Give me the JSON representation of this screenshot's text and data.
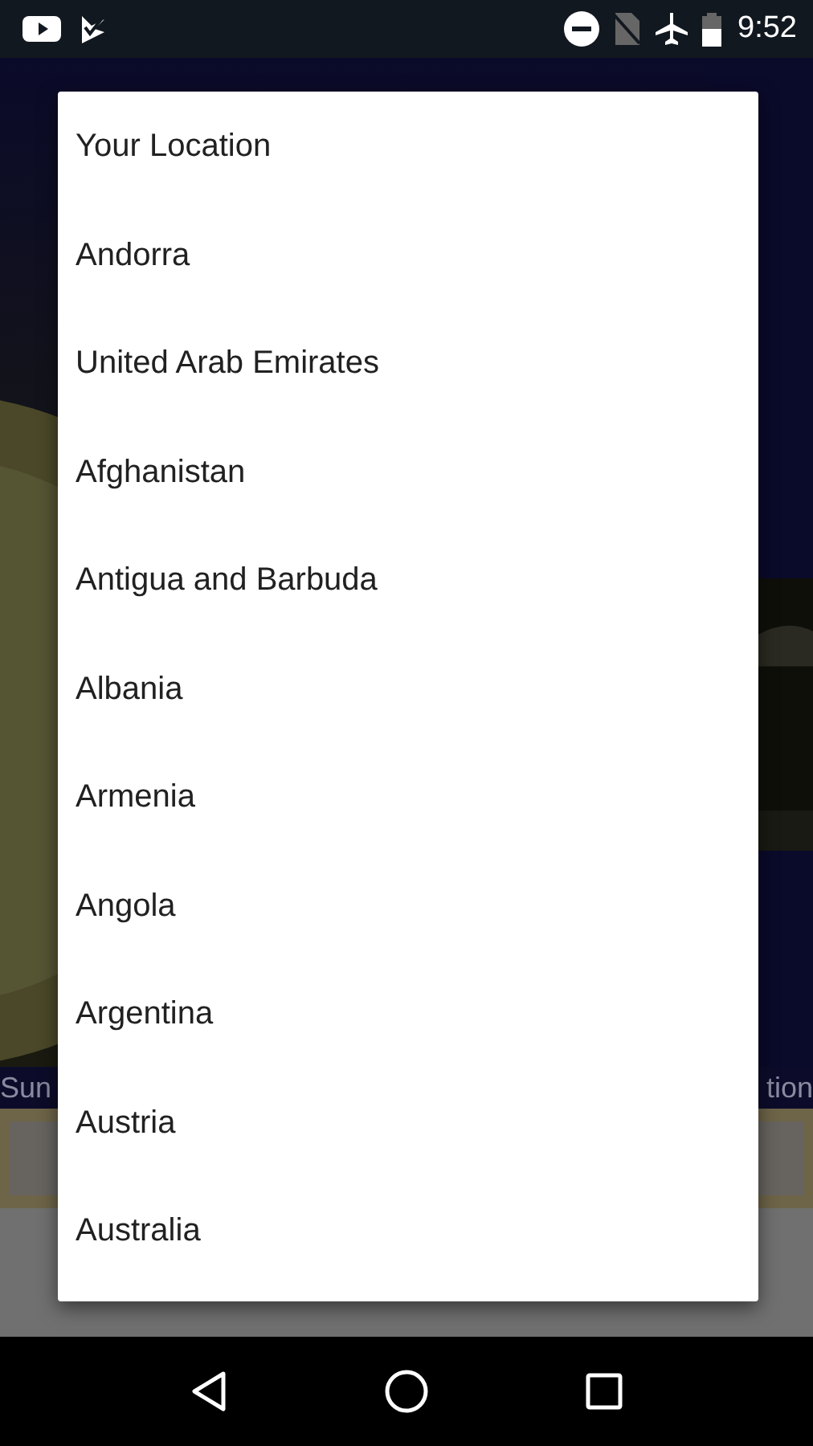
{
  "status_bar": {
    "time": "9:52"
  },
  "background": {
    "caption_left": "Sun",
    "caption_right": "tion"
  },
  "dialog": {
    "items": [
      "Your Location",
      "Andorra",
      "United Arab Emirates",
      "Afghanistan",
      "Antigua and Barbuda",
      "Albania",
      "Armenia",
      "Angola",
      "Argentina",
      "Austria",
      "Australia"
    ]
  }
}
